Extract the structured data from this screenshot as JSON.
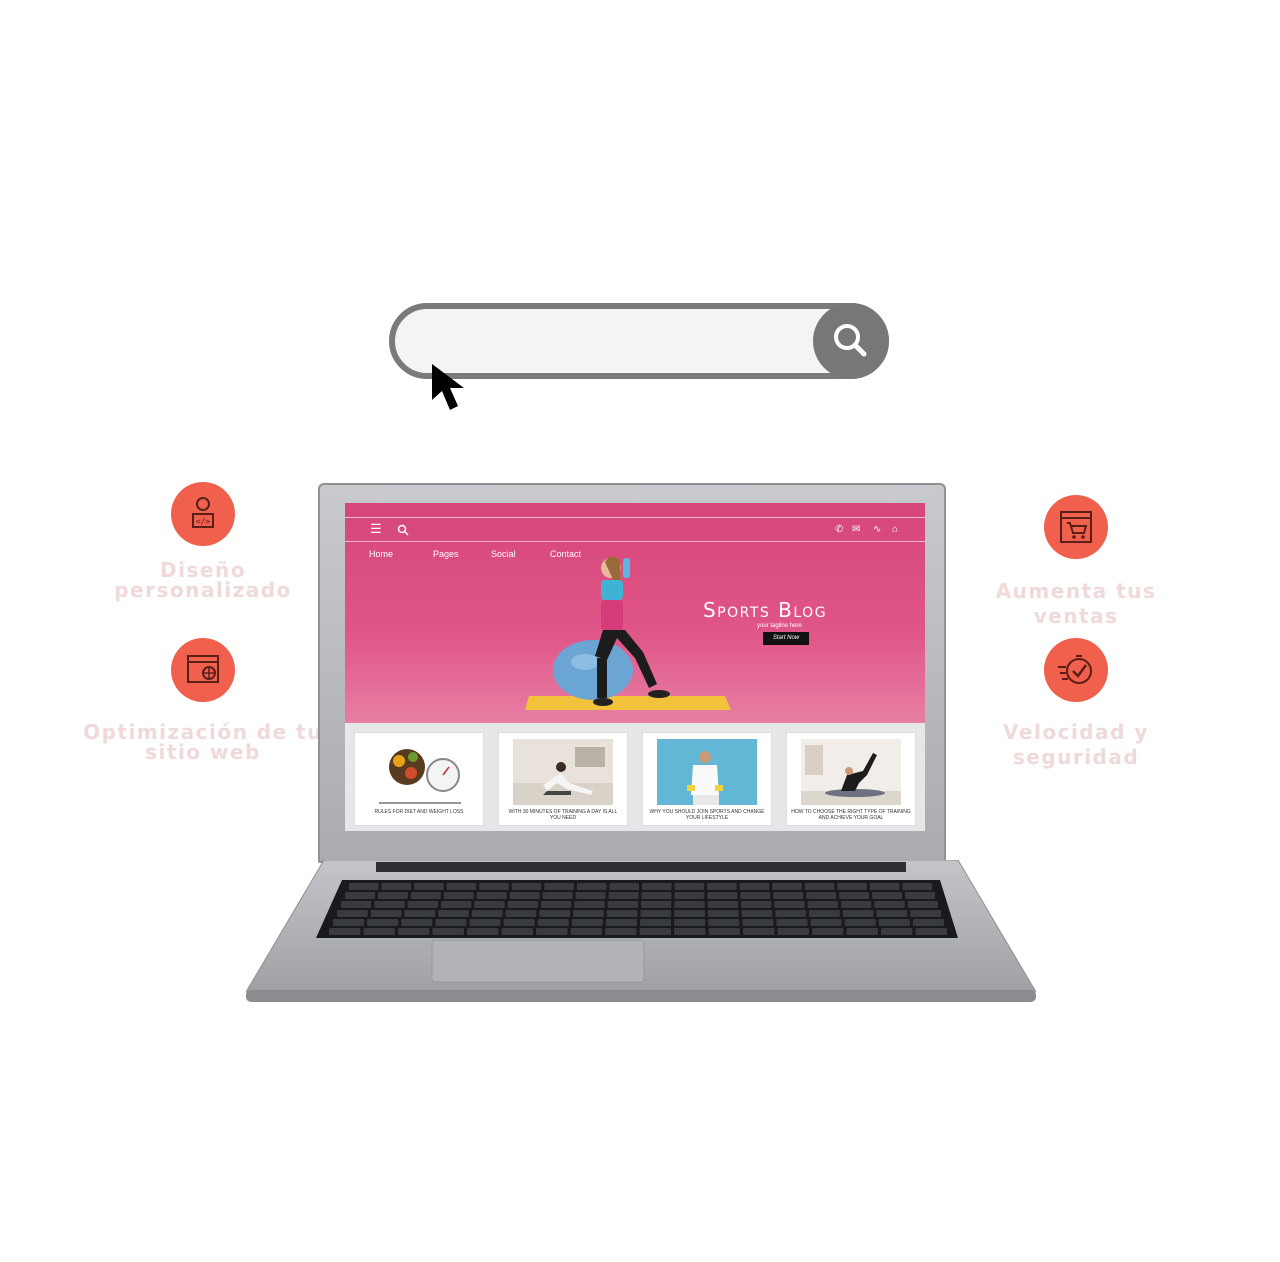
{
  "search": {
    "placeholder": "",
    "value": ""
  },
  "features": {
    "left_top": {
      "label": "Diseño\npersonalizado",
      "icon": "developer-icon"
    },
    "left_bottom": {
      "label": "Optimización de tu\nsitio web",
      "icon": "seo-browser-icon"
    },
    "right_top": {
      "label": "Aumenta tus\nventas",
      "icon": "shopping-cart-icon"
    },
    "right_bottom": {
      "label": "Velocidad y\nseguridad",
      "icon": "fast-check-icon"
    }
  },
  "website": {
    "nav": [
      "Home",
      "Pages",
      "Social",
      "Contact"
    ],
    "title": "Sports Blog",
    "tagline": "your tagline here",
    "cta": "Start Now",
    "cards": [
      {
        "caption": "RULES FOR DIET AND WEIGHT LOSS"
      },
      {
        "caption": "WITH 30 MINUTES OF TRAINING A DAY IS ALL YOU NEED"
      },
      {
        "caption": "WHY YOU SHOULD JOIN SPORTS AND CHANGE YOUR LIFESTYLE"
      },
      {
        "caption": "HOW TO CHOOSE THE RIGHT TYPE OF TRAINING AND ACHIEVE YOUR GOAL"
      }
    ]
  },
  "colors": {
    "accent": "#f0604c",
    "hero": "#d6467a",
    "label": "#efd9d9",
    "searchbar": "#777777"
  }
}
